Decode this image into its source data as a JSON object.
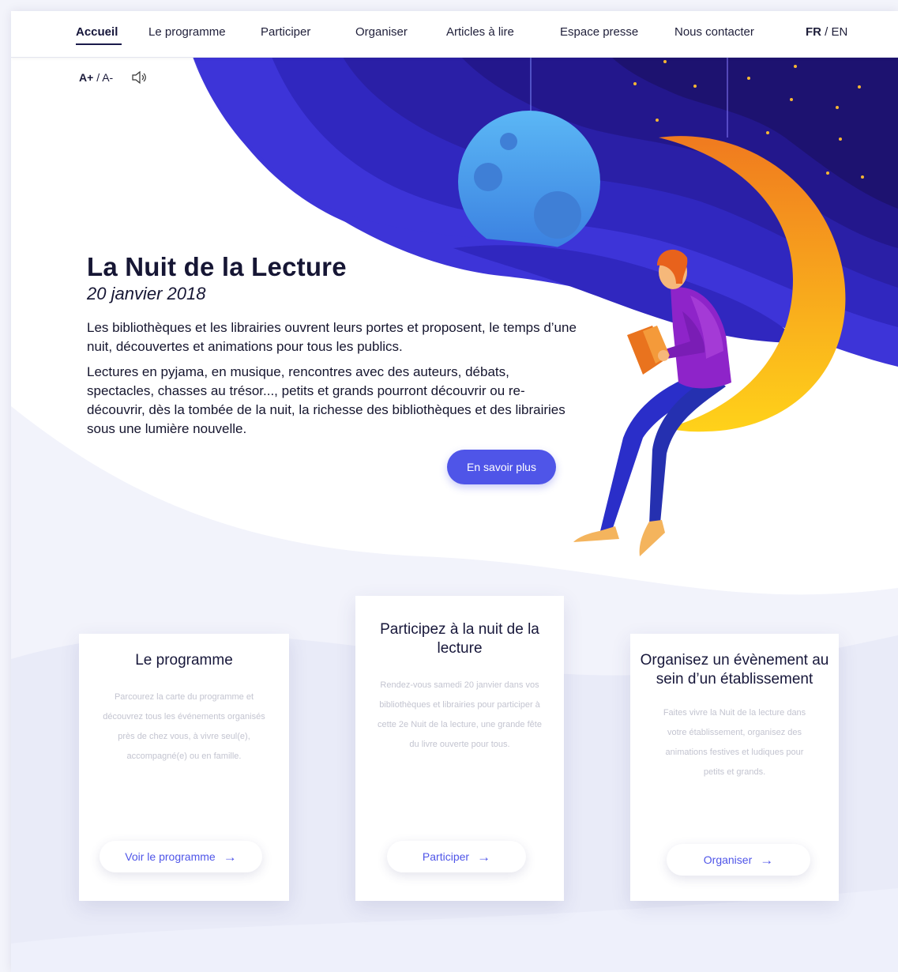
{
  "nav": {
    "items": [
      {
        "label": "Accueil",
        "active": true
      },
      {
        "label": "Le programme",
        "active": false
      },
      {
        "label": "Participer",
        "active": false
      },
      {
        "label": "Organiser",
        "active": false
      },
      {
        "label": "Articles à lire",
        "active": false
      },
      {
        "label": "Espace presse",
        "active": false
      },
      {
        "label": "Nous contacter",
        "active": false
      }
    ],
    "lang": {
      "current": "FR",
      "separator": "/",
      "other": "EN"
    }
  },
  "accessibility": {
    "increase": "A+",
    "separator": "/",
    "decrease": "A-",
    "speaker_icon": "speaker-icon"
  },
  "hero": {
    "title": "La Nuit de la Lecture",
    "date": "20 janvier 2018",
    "paragraphs": [
      "Les bibliothèques et les librairies ouvrent leurs portes et proposent, le temps d’une nuit, découvertes et animations pour tous les publics.",
      "Lectures en pyjama, en musique, rencontres avec des auteurs, débats, spectacles, chasses au trésor..., petits et grands pourront découvrir ou re-découvrir, dès la tombée de la nuit, la richesse des bibliothèques et des librairies sous une lumière nouvelle."
    ],
    "cta": "En savoir plus"
  },
  "cards": [
    {
      "title": "Le programme",
      "description": "Parcourez la carte du programme et découvrez tous les événements organisés près de chez vous, à vivre seul(e), accompagné(e) ou en famille.",
      "button": "Voir le programme"
    },
    {
      "title": "Participez à la nuit de la lecture",
      "description": "Rendez-vous samedi 20 janvier dans vos bibliothèques et librairies pour participer à cette 2e Nuit de la lecture, une grande fête du livre ouverte pour tous.",
      "button": "Participer"
    },
    {
      "title": "Organisez un évènement au sein d’un établissement",
      "description": "Faites vivre la Nuit de la lecture dans votre établissement, organisez des animations festives et ludiques pour petits et grands.",
      "button": "Organiser"
    }
  ],
  "colors": {
    "accent": "#4f55e8",
    "night_dark": "#1d1270",
    "night_mid": "#3b2fc9",
    "moon": "#f7a21a",
    "planet": "#4fa3f0",
    "text": "#15152e"
  }
}
